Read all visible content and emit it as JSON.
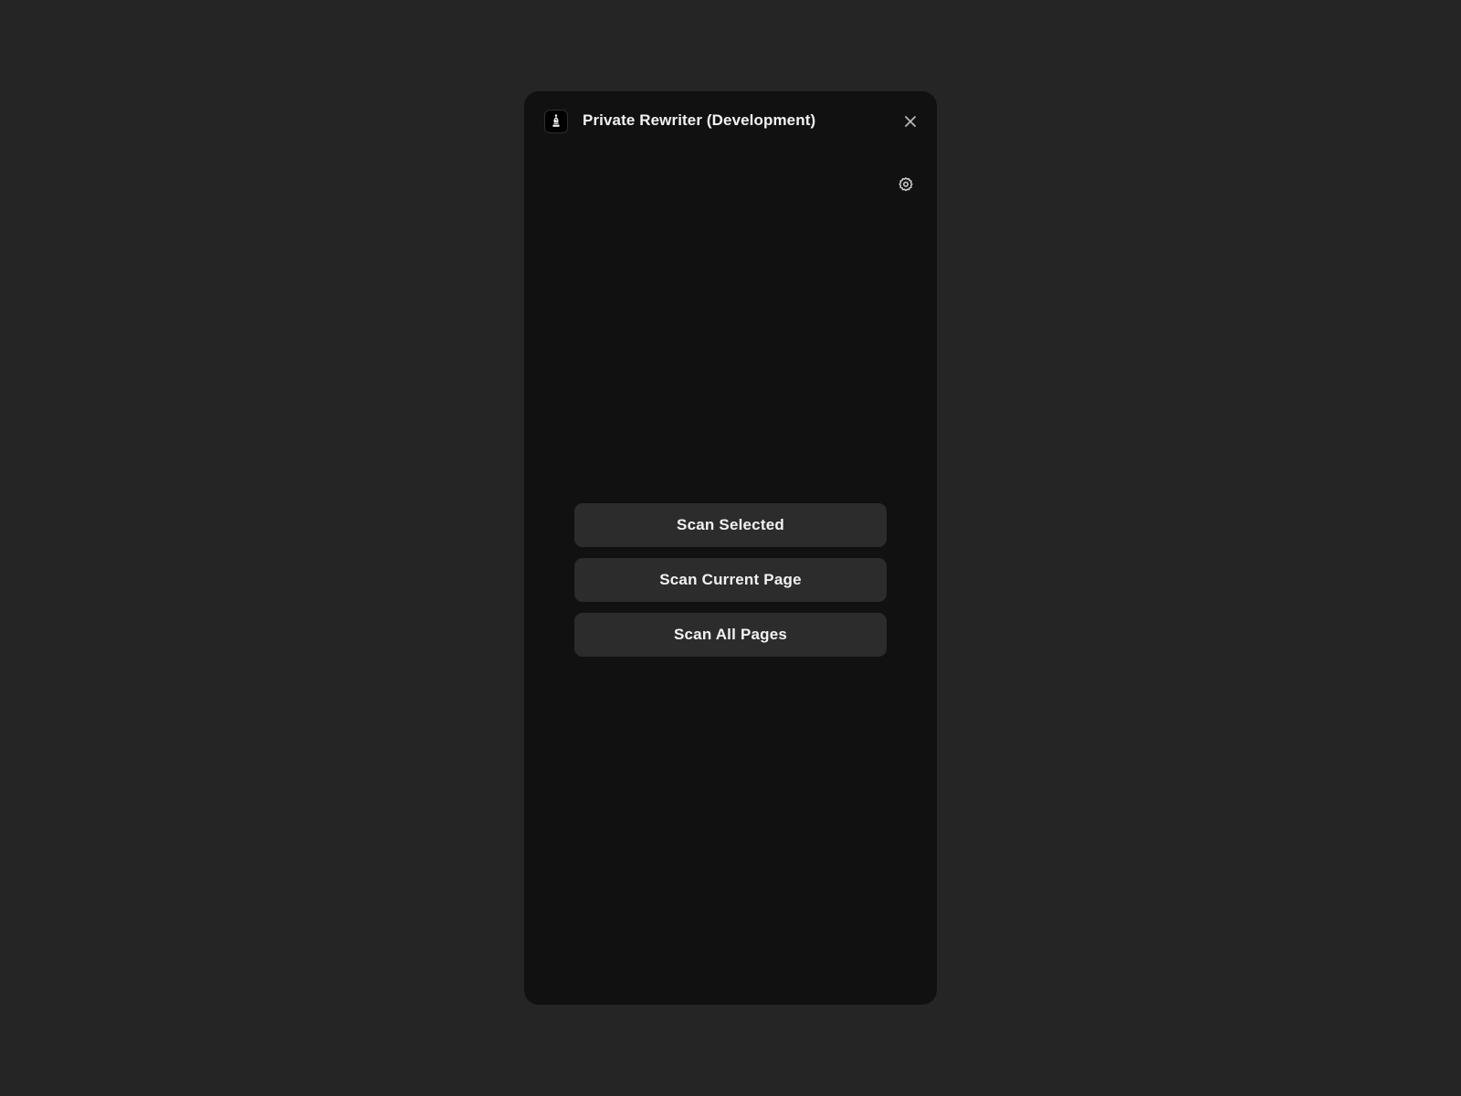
{
  "header": {
    "app_icon": "bishop-chess-icon",
    "title": "Private Rewriter (Development)",
    "close_icon": "close-icon"
  },
  "toolbar": {
    "settings_icon": "gear-icon"
  },
  "actions": {
    "scan_selected_label": "Scan Selected",
    "scan_current_page_label": "Scan Current Page",
    "scan_all_pages_label": "Scan All Pages"
  },
  "colors": {
    "background": "#252525",
    "panel": "#111111",
    "button": "#2c2c2c",
    "text": "#f2f2f2",
    "icon": "#bdbdbd"
  }
}
